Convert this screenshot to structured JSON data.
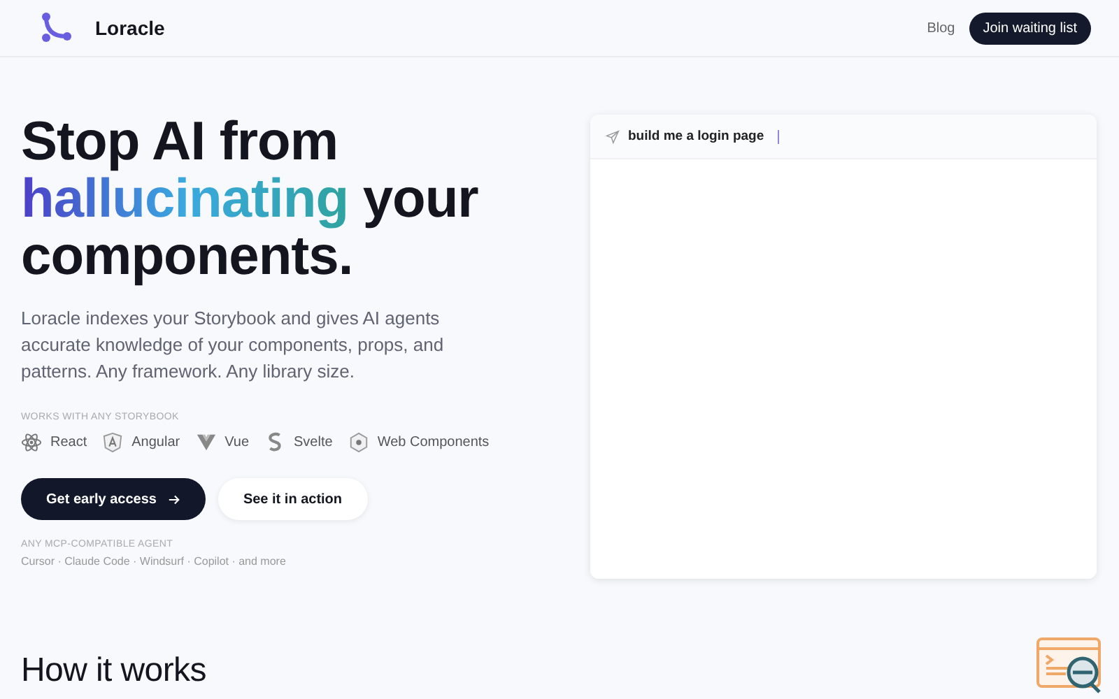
{
  "header": {
    "brand": "Loracle",
    "nav_link": "Blog",
    "cta": "Join waiting list"
  },
  "hero": {
    "line1": "Stop AI from",
    "highlight": "hallucinating",
    "line2_rest": "your",
    "line3": "components.",
    "description": "Loracle indexes your Storybook and gives AI agents accurate knowledge of your components, props, and patterns. Any framework. Any library size.",
    "frameworks_label": "WORKS WITH ANY STORYBOOK",
    "frameworks": [
      {
        "kind": "react",
        "label": "React"
      },
      {
        "kind": "angular",
        "label": "Angular"
      },
      {
        "kind": "vue",
        "label": "Vue"
      },
      {
        "kind": "svelte",
        "label": "Svelte"
      },
      {
        "kind": "webcomponents",
        "label": "Web Components"
      }
    ],
    "primary_button": "Get early access",
    "secondary_button": "See it in action",
    "agents_label": "ANY MCP-COMPATIBLE AGENT",
    "agents": "Cursor · Claude Code · Windsurf · Copilot · and more"
  },
  "demo": {
    "prompt": "build me a login page"
  },
  "section_title": "How it works"
}
